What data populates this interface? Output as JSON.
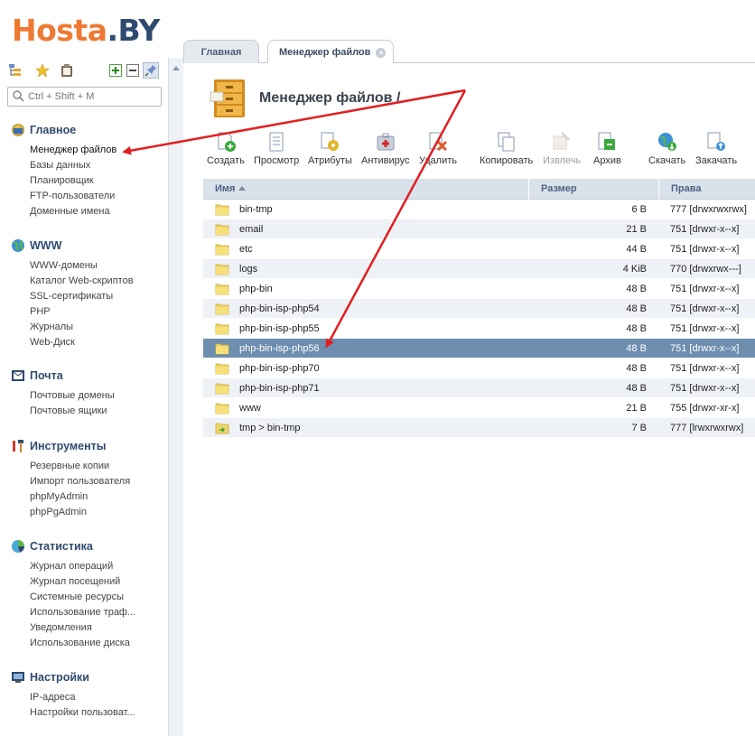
{
  "logo": {
    "part1": "Hosta",
    "part2": ".BY"
  },
  "search": {
    "placeholder": "Ctrl + Shift + M",
    "value": ""
  },
  "sidebar": {
    "groups": [
      {
        "title": "Главное",
        "icon": "home-icon",
        "items": [
          "Менеджер файлов",
          "Базы данных",
          "Планировщик",
          "FTP-пользователи",
          "Доменные имена"
        ]
      },
      {
        "title": "WWW",
        "icon": "globe-icon",
        "items": [
          "WWW-домены",
          "Каталог Web-скриптов",
          "SSL-сертификаты",
          "PHP",
          "Журналы",
          "Web-Диск"
        ]
      },
      {
        "title": "Почта",
        "icon": "mail-icon",
        "items": [
          "Почтовые домены",
          "Почтовые ящики"
        ]
      },
      {
        "title": "Инструменты",
        "icon": "tools-icon",
        "items": [
          "Резервные копии",
          "Импорт пользователя",
          "phpMyAdmin",
          "phpPgAdmin"
        ]
      },
      {
        "title": "Статистика",
        "icon": "stats-icon",
        "items": [
          "Журнал операций",
          "Журнал посещений",
          "Системные ресурсы",
          "Использование траф...",
          "Уведомления",
          "Использование диска"
        ]
      },
      {
        "title": "Настройки",
        "icon": "settings-icon",
        "items": [
          "IP-адреса",
          "Настройки пользоват..."
        ]
      }
    ]
  },
  "tabs": [
    {
      "label": "Главная"
    },
    {
      "label": "Менеджер файлов"
    }
  ],
  "page": {
    "title": "Менеджер файлов /"
  },
  "toolbar": {
    "buttons": [
      {
        "label": "Создать",
        "icon": "new-file-icon",
        "disabled": false
      },
      {
        "label": "Просмотр",
        "icon": "view-icon",
        "disabled": false
      },
      {
        "label": "Атрибуты",
        "icon": "attributes-icon",
        "disabled": false
      },
      {
        "label": "Антивирус",
        "icon": "antivirus-icon",
        "disabled": false
      },
      {
        "label": "Удалить",
        "icon": "delete-icon",
        "disabled": false
      },
      {
        "label": "Копировать",
        "icon": "copy-icon",
        "disabled": false
      },
      {
        "label": "Извлечь",
        "icon": "extract-icon",
        "disabled": true
      },
      {
        "label": "Архив",
        "icon": "archive-icon",
        "disabled": false
      },
      {
        "label": "Скачать",
        "icon": "download-icon",
        "disabled": false
      },
      {
        "label": "Закачать",
        "icon": "upload-icon",
        "disabled": false
      }
    ]
  },
  "table": {
    "columns": [
      "Имя",
      "Размер",
      "Права"
    ],
    "rows": [
      {
        "name": "bin-tmp",
        "size": "6 B",
        "rights": "777 [drwxrwxrwx]",
        "type": "folder"
      },
      {
        "name": "email",
        "size": "21 B",
        "rights": "751 [drwxr-x--x]",
        "type": "folder"
      },
      {
        "name": "etc",
        "size": "44 B",
        "rights": "751 [drwxr-x--x]",
        "type": "folder"
      },
      {
        "name": "logs",
        "size": "4 KiB",
        "rights": "770 [drwxrwx---]",
        "type": "folder"
      },
      {
        "name": "php-bin",
        "size": "48 B",
        "rights": "751 [drwxr-x--x]",
        "type": "folder"
      },
      {
        "name": "php-bin-isp-php54",
        "size": "48 B",
        "rights": "751 [drwxr-x--x]",
        "type": "folder"
      },
      {
        "name": "php-bin-isp-php55",
        "size": "48 B",
        "rights": "751 [drwxr-x--x]",
        "type": "folder"
      },
      {
        "name": "php-bin-isp-php56",
        "size": "48 B",
        "rights": "751 [drwxr-x--x]",
        "type": "folder",
        "selected": true
      },
      {
        "name": "php-bin-isp-php70",
        "size": "48 B",
        "rights": "751 [drwxr-x--x]",
        "type": "folder"
      },
      {
        "name": "php-bin-isp-php71",
        "size": "48 B",
        "rights": "751 [drwxr-x--x]",
        "type": "folder"
      },
      {
        "name": "www",
        "size": "21 B",
        "rights": "755 [drwxr-xr-x]",
        "type": "folder"
      },
      {
        "name": "tmp > bin-tmp",
        "size": "7 B",
        "rights": "777 [lrwxrwxrwx]",
        "type": "symlink"
      }
    ]
  },
  "colors": {
    "accent_orange": "#ee7a33",
    "brand_navy": "#2f4a6f",
    "selected_row": "#6e8eb0",
    "annotation_arrow": "#e02020"
  }
}
